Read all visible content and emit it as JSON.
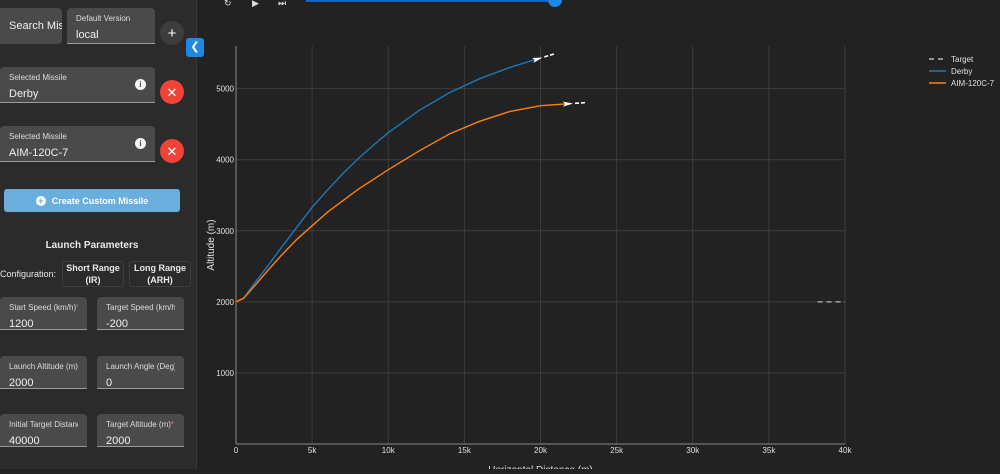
{
  "sidebar": {
    "search_label": "Search Mis",
    "default_version": {
      "label": "Default Version",
      "value": "local"
    },
    "selected_missiles": [
      {
        "label": "Selected Missile",
        "value": "Derby"
      },
      {
        "label": "Selected Missile",
        "value": "AIM-120C-7"
      }
    ],
    "create_label": "Create Custom Missile",
    "launch_params": {
      "title": "Launch Parameters",
      "config_label": "Configuration:",
      "config_options": [
        "Short Range (IR)",
        "Long Range (ARH)"
      ],
      "fields": [
        {
          "label": "Start Speed (km/h)",
          "value": "1200"
        },
        {
          "label": "Target Speed (km/h)",
          "value": "-200"
        },
        {
          "label": "Launch Altitude (m)",
          "value": "2000"
        },
        {
          "label": "Launch Angle (Deg)",
          "value": "0"
        },
        {
          "label": "Initial Target Distance",
          "value": "40000"
        },
        {
          "label": "Target Altitude (m)",
          "value": "2000"
        }
      ]
    }
  },
  "icons": {
    "add": "plus-icon",
    "remove": "close-icon",
    "info": "info-icon",
    "collapse": "chevron-left-icon",
    "playback": [
      "replay-icon",
      "play-icon",
      "skip-forward-icon"
    ]
  },
  "colors": {
    "derby": "#1f77b4",
    "aim120": "#ff7f0e",
    "target": "#bbbbbb",
    "remove_button": "#f04438",
    "create_button": "#6aaedd",
    "collapse_button": "#1e88e5"
  },
  "chart_data": {
    "type": "line",
    "title": "",
    "xlabel": "Horizontal Distance (m)",
    "ylabel": "Altitude (m)",
    "xlim": [
      0,
      40000
    ],
    "ylim": [
      0,
      5600
    ],
    "x_ticks": [
      "0",
      "5k",
      "10k",
      "15k",
      "20k",
      "25k",
      "30k",
      "35k",
      "40k"
    ],
    "y_ticks": [
      "1000",
      "2000",
      "3000",
      "4000",
      "5000"
    ],
    "grid": true,
    "legend_position": "top-right",
    "series": [
      {
        "name": "Target",
        "style": "dashed",
        "x": [
          38200,
          40000
        ],
        "y": [
          2000,
          2000
        ]
      },
      {
        "name": "Derby",
        "style": "solid",
        "x": [
          0,
          500,
          1000,
          2000,
          3000,
          4000,
          5000,
          6000,
          7000,
          8000,
          9000,
          10000,
          12000,
          14000,
          16000,
          18000,
          20000
        ],
        "y": [
          2000,
          2050,
          2200,
          2480,
          2770,
          3050,
          3330,
          3570,
          3800,
          4010,
          4200,
          4380,
          4690,
          4940,
          5140,
          5300,
          5430
        ]
      },
      {
        "name": "AIM-120C-7",
        "style": "solid",
        "x": [
          0,
          500,
          1000,
          2000,
          3000,
          4000,
          5000,
          6000,
          8000,
          10000,
          12000,
          14000,
          16000,
          18000,
          20000,
          22000
        ],
        "y": [
          2000,
          2050,
          2170,
          2420,
          2660,
          2880,
          3070,
          3260,
          3580,
          3860,
          4120,
          4360,
          4540,
          4680,
          4760,
          4790
        ]
      }
    ]
  }
}
